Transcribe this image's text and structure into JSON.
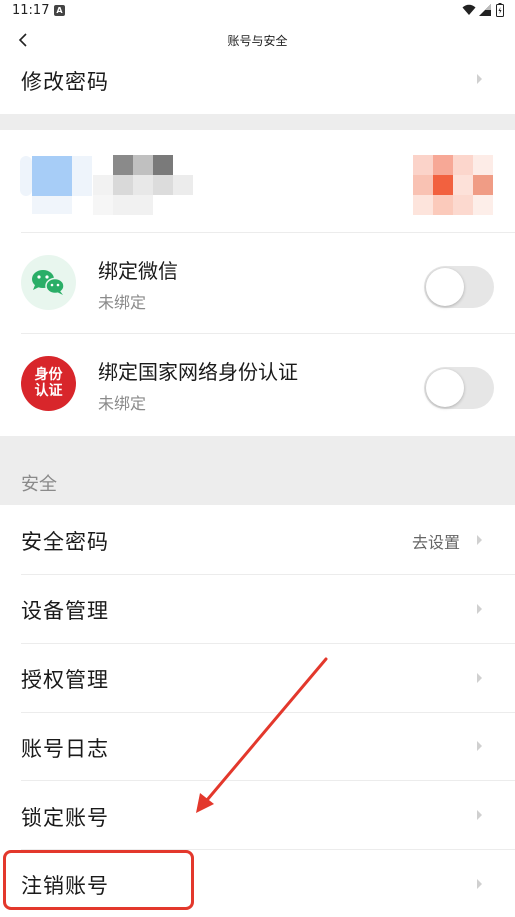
{
  "status_bar": {
    "time": "11:17",
    "app_badge": "A"
  },
  "nav": {
    "title": "账号与安全",
    "back_icon": "back-chevron-icon"
  },
  "change_password": {
    "label": "修改密码"
  },
  "bindings": [
    {
      "title": "绑定微信",
      "status": "未绑定",
      "icon": "wechat-icon",
      "icon_color": "#2aae67"
    },
    {
      "title": "绑定国家网络身份认证",
      "status": "未绑定",
      "icon": "national-id-icon",
      "icon_color": "#d8262b",
      "icon_text": "身份认证"
    }
  ],
  "security": {
    "section_title": "安全",
    "items": [
      {
        "label": "安全密码",
        "value": "去设置"
      },
      {
        "label": "设备管理"
      },
      {
        "label": "授权管理"
      },
      {
        "label": "账号日志"
      },
      {
        "label": "锁定账号"
      },
      {
        "label": "注销账号"
      }
    ]
  },
  "colors": {
    "annotation": "#e3382c",
    "band": "#ededed",
    "toggle_off": "#e6e6e6"
  }
}
